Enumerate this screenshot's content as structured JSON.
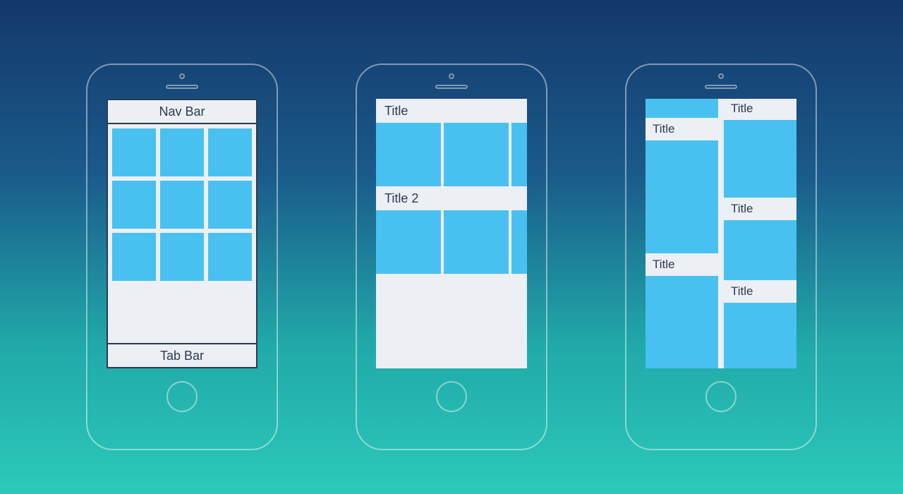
{
  "phones": {
    "p1": {
      "nav_label": "Nav Bar",
      "tab_label": "Tab Bar"
    },
    "p2": {
      "section1": "Title",
      "section2": "Title 2"
    },
    "p3": {
      "left": {
        "t1": "Title",
        "t2": "Title"
      },
      "right": {
        "t1": "Title",
        "t2": "Title",
        "t3": "Title"
      }
    }
  }
}
